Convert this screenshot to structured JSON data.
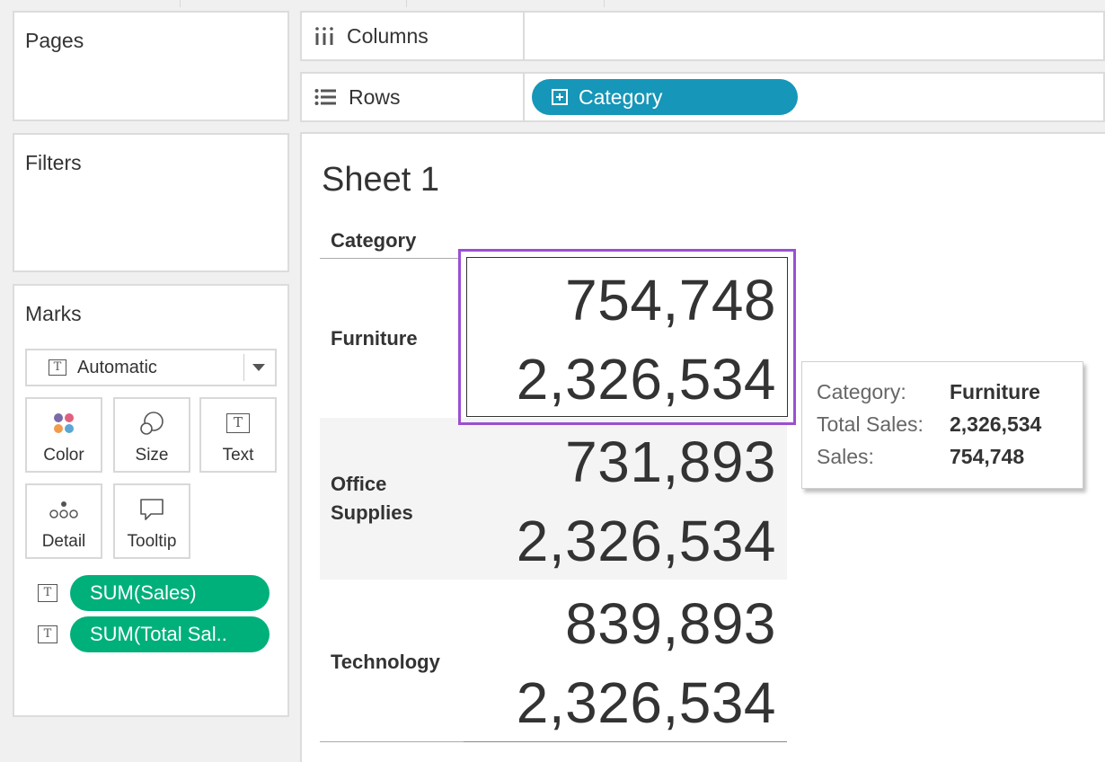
{
  "panels": {
    "pages": "Pages",
    "filters": "Filters",
    "marks": "Marks"
  },
  "marks": {
    "type": "Automatic",
    "cards": [
      "Color",
      "Size",
      "Text",
      "Detail",
      "Tooltip"
    ],
    "fields": [
      "SUM(Sales)",
      "SUM(Total Sal.."
    ],
    "field_icon": "T"
  },
  "shelves": {
    "columns": "Columns",
    "rows": "Rows",
    "row_pill": "Category"
  },
  "sheet": {
    "title": "Sheet 1",
    "column_header": "Category",
    "rows": [
      {
        "label_lines": [
          "Furniture"
        ],
        "sales": "754,748",
        "total_sales": "2,326,534"
      },
      {
        "label_lines": [
          "Office",
          "Supplies"
        ],
        "sales": "731,893",
        "total_sales": "2,326,534"
      },
      {
        "label_lines": [
          "Technology"
        ],
        "sales": "839,893",
        "total_sales": "2,326,534"
      }
    ]
  },
  "tooltip": {
    "rows": [
      {
        "key": "Category:",
        "value": "Furniture"
      },
      {
        "key": "Total Sales:",
        "value": "2,326,534"
      },
      {
        "key": "Sales:",
        "value": "754,748"
      }
    ]
  },
  "colors": {
    "row_pill": "#1696b8",
    "measure_pill": "#00b07a",
    "selection": "#9b4fd1"
  }
}
